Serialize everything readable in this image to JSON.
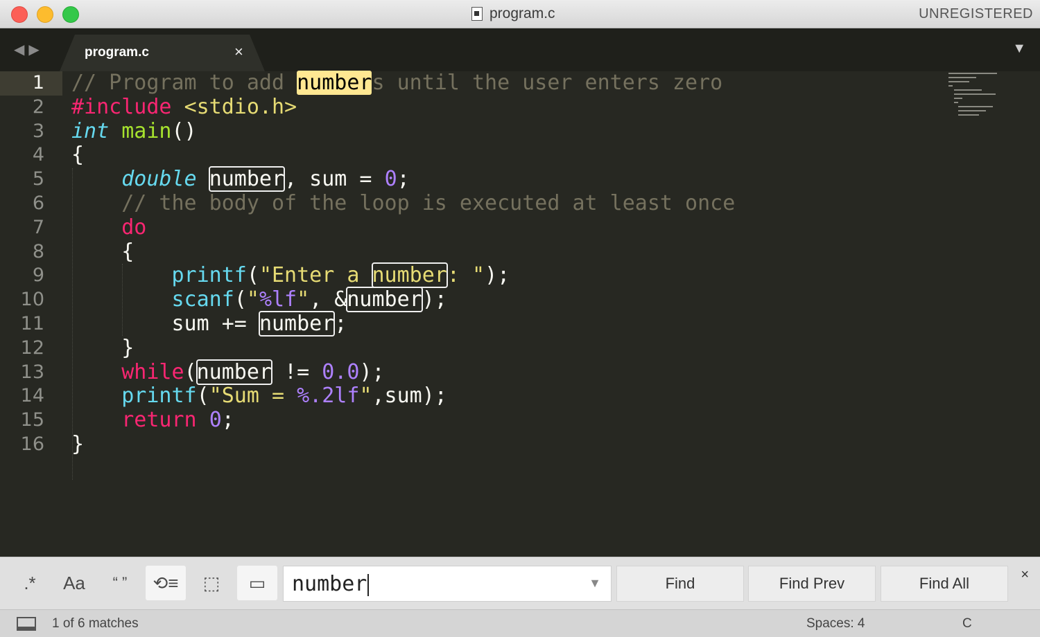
{
  "window": {
    "title": "program.c",
    "registration": "UNREGISTERED"
  },
  "tab": {
    "label": "program.c",
    "close": "×"
  },
  "editor": {
    "current_line": 1,
    "line_numbers": [
      "1",
      "2",
      "3",
      "4",
      "5",
      "6",
      "7",
      "8",
      "9",
      "10",
      "11",
      "12",
      "13",
      "14",
      "15",
      "16"
    ],
    "lines": [
      [
        [
          "com",
          "// Program to add "
        ],
        [
          "sel",
          "number"
        ],
        [
          "com",
          "s until the user enters zero"
        ]
      ],
      [
        [
          "kw",
          "#include "
        ],
        [
          "str",
          "<stdio.h>"
        ]
      ],
      [
        [
          "type",
          "int"
        ],
        [
          "",
          " "
        ],
        [
          "fn",
          "main"
        ],
        [
          "",
          "()"
        ]
      ],
      [
        [
          "",
          "{"
        ]
      ],
      [
        [
          "",
          "    "
        ],
        [
          "type",
          "double"
        ],
        [
          "",
          " "
        ],
        [
          "match",
          "number"
        ],
        [
          "",
          ", sum = "
        ],
        [
          "num",
          "0"
        ],
        [
          "",
          ";"
        ]
      ],
      [
        [
          "",
          "    "
        ],
        [
          "com",
          "// the body of the loop is executed at least once"
        ]
      ],
      [
        [
          "",
          "    "
        ],
        [
          "kw",
          "do"
        ]
      ],
      [
        [
          "",
          "    {"
        ]
      ],
      [
        [
          "",
          "        "
        ],
        [
          "bfn",
          "printf"
        ],
        [
          "",
          "("
        ],
        [
          "str",
          "\"Enter a "
        ],
        [
          "match-str",
          "number"
        ],
        [
          "str",
          ": \""
        ],
        [
          "",
          ");"
        ]
      ],
      [
        [
          "",
          "        "
        ],
        [
          "bfn",
          "scanf"
        ],
        [
          "",
          "("
        ],
        [
          "str",
          "\""
        ],
        [
          "num",
          "%lf"
        ],
        [
          "str",
          "\""
        ],
        [
          "",
          ", &"
        ],
        [
          "match",
          "number"
        ],
        [
          "",
          ");"
        ]
      ],
      [
        [
          "",
          "        sum += "
        ],
        [
          "match",
          "number"
        ],
        [
          "",
          ";"
        ]
      ],
      [
        [
          "",
          "    }"
        ]
      ],
      [
        [
          "",
          "    "
        ],
        [
          "kw",
          "while"
        ],
        [
          "",
          "("
        ],
        [
          "match",
          "number"
        ],
        [
          "",
          " != "
        ],
        [
          "num",
          "0.0"
        ],
        [
          "",
          ");"
        ]
      ],
      [
        [
          "",
          "    "
        ],
        [
          "bfn",
          "printf"
        ],
        [
          "",
          "("
        ],
        [
          "str",
          "\"Sum = "
        ],
        [
          "num",
          "%.2lf"
        ],
        [
          "str",
          "\""
        ],
        [
          "",
          ",sum);"
        ]
      ],
      [
        [
          "",
          "    "
        ],
        [
          "kw",
          "return"
        ],
        [
          "",
          " "
        ],
        [
          "num",
          "0"
        ],
        [
          "",
          ";"
        ]
      ],
      [
        [
          "",
          "}"
        ]
      ]
    ]
  },
  "find": {
    "options": {
      "regex": ".*",
      "case": "Aa",
      "whole_word": "“ ”",
      "wrap": "⟲≡",
      "in_selection": "⬚",
      "highlight": "▭"
    },
    "query": "number",
    "buttons": {
      "find": "Find",
      "find_prev": "Find Prev",
      "find_all": "Find All"
    },
    "close": "×"
  },
  "status": {
    "matches": "1 of 6 matches",
    "indent": "Spaces: 4",
    "syntax": "C"
  }
}
